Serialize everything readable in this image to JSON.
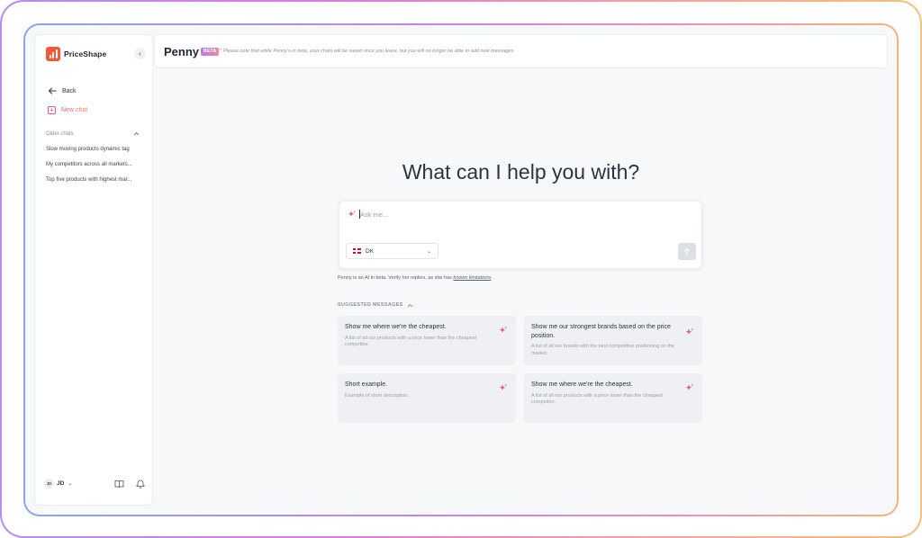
{
  "sidebar": {
    "brand": "PriceShape",
    "back_label": "Back",
    "new_chat_label": "New chat",
    "older_chats_label": "Older chats",
    "older_chats": [
      "Slow moving products dynamic tag",
      "My competitors across all markets...",
      "Top five products with highest mar..."
    ],
    "user_initials": "JD",
    "user_name": "JD"
  },
  "header": {
    "title": "Penny",
    "badge": "BETA",
    "separator": "•",
    "note": "Please note that while Penny's in beta, your chats will be saved once you leave, but you will no longer be able to add new messages."
  },
  "main": {
    "heading": "What can I help you with?",
    "input_placeholder": "Ask me...",
    "country": "DK",
    "disclaimer_prefix": "Penny is an AI in beta. Verify her replies, as she has ",
    "disclaimer_link": "known limitations",
    "disclaimer_suffix": ".",
    "suggested_label": "SUGGESTED MESSAGES",
    "suggestions": [
      {
        "title": "Show me where we're the cheapest.",
        "desc": "A list of all our products with a price lower than the cheapest competitor."
      },
      {
        "title": "Show me our strongest brands based on the price position.",
        "desc": "A list of all our brands with the best competitive positioning on the market."
      },
      {
        "title": "Short example.",
        "desc": "Example of short description."
      },
      {
        "title": "Show me where we're the cheapest.",
        "desc": "A list of all our products with a price lower than the cheapest competitor."
      }
    ]
  },
  "colors": {
    "brand": "#ee5a3a",
    "accent_pink": "#e05c8a",
    "text": "#2b3442"
  },
  "icons": {
    "back": "arrow-left-icon",
    "new_chat": "plus-square-icon",
    "sparkle": "sparkle-icon",
    "send": "arrow-up-icon",
    "docs": "book-icon",
    "notifications": "bell-icon"
  }
}
